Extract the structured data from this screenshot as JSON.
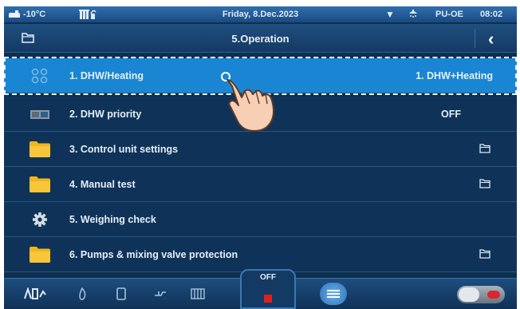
{
  "status_bar": {
    "outside_temp": "-10°C",
    "date": "Friday, 8.Dec.2023",
    "mode": "PU-OE",
    "time": "08:02"
  },
  "title_bar": {
    "title": "5.Operation"
  },
  "menu_items": [
    {
      "label": "1. DHW/Heating",
      "value": "1. DHW+Heating",
      "icon": "circuits-icon",
      "selected": true
    },
    {
      "label": "2. DHW priority",
      "value": "OFF",
      "icon": "tank-icon"
    },
    {
      "label": "3. Control unit settings",
      "value": "",
      "icon": "folder-icon"
    },
    {
      "label": "4. Manual test",
      "value": "",
      "icon": "folder-icon"
    },
    {
      "label": "5. Weighing check",
      "value": "",
      "icon": "gear-icon"
    },
    {
      "label": "6. Pumps & mixing valve protection",
      "value": "",
      "icon": "folder-icon"
    }
  ],
  "bottom_bar": {
    "operation_state": "OFF"
  },
  "colors": {
    "background": "#0d2f50",
    "selected_row": "#1a86d3",
    "folder_yellow": "#f2b51e",
    "stop_red": "#e0201c"
  }
}
